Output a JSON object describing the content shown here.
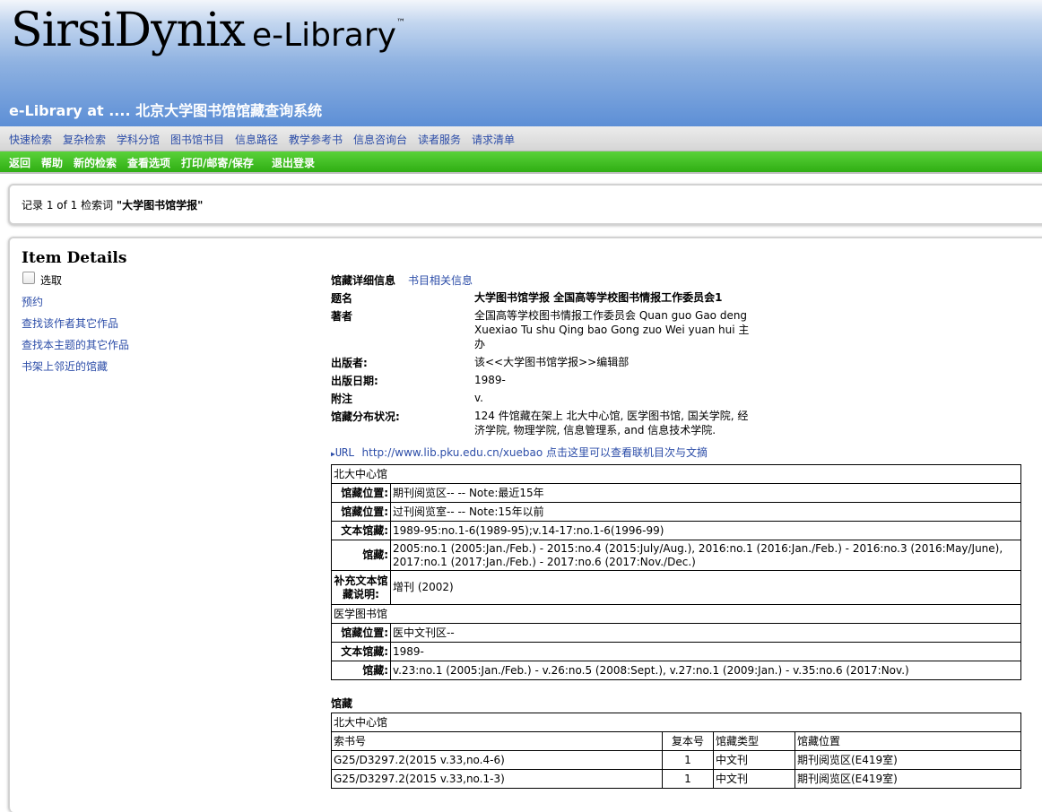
{
  "brand": {
    "name": "SirsiDynix",
    "product": "e-Library",
    "trademark": "™"
  },
  "site_title": "e-Library at .... 北京大学图书馆馆藏查询系统",
  "nav": [
    "快速检索",
    "复杂检索",
    "学科分馆",
    "图书馆书目",
    "信息路径",
    "教学参考书",
    "信息咨询台",
    "读者服务",
    "请求清单"
  ],
  "actions": [
    "返回",
    "帮助",
    "新的检索",
    "查看选项",
    "打印/邮寄/保存",
    "退出登录"
  ],
  "records": {
    "prefix": "记录 1 of 1 检索词 ",
    "term": "\"大学图书馆学报\""
  },
  "item_details": {
    "heading": "Item Details",
    "select_label": "选取",
    "links": [
      "预约",
      "查找该作者其它作品",
      "查找本主题的其它作品",
      "书架上邻近的馆藏"
    ]
  },
  "tabs": {
    "holdings": "馆藏详细信息",
    "bib": "书目相关信息"
  },
  "record": {
    "title_label": "题名",
    "title": "大学图书馆学报 全国高等学校图书情报工作委员会1",
    "author_label": "著者",
    "author_lines": [
      "全国高等学校图书情报工作委员会 Quan guo Gao deng",
      "Xuexiao Tu shu Qing bao Gong zuo Wei yuan hui 主",
      "办"
    ],
    "publisher_label": "出版者:",
    "publisher": "该<<大学图书馆学报>>编辑部",
    "date_label": "出版日期:",
    "date": "1989-",
    "note_label": "附注",
    "note": "v.",
    "dist_label": "馆藏分布状况:",
    "dist_lines": [
      "124 件馆藏在架上 北大中心馆, 医学图书馆, 国关学院, 经",
      "济学院, 物理学院, 信息管理系, and 信息技术学院."
    ]
  },
  "url": {
    "label": "URL",
    "text": "http://www.lib.pku.edu.cn/xuebao 点击这里可以查看联机目次与文摘"
  },
  "summary": {
    "library1": "北大中心馆",
    "loc_label": "馆藏位置:",
    "loc1a": "期刊阅览区-- -- Note:最近15年",
    "loc1b": "过刊阅览室-- -- Note:15年以前",
    "text_label": "文本馆藏:",
    "text1": "1989-95:no.1-6(1989-95);v.14-17:no.1-6(1996-99)",
    "holdings_label": "馆藏:",
    "holdings1": "2005:no.1 (2005:Jan./Feb.) - 2015:no.4 (2015:July/Aug.), 2016:no.1 (2016:Jan./Feb.) - 2016:no.3 (2016:May/June), 2017:no.1 (2017:Jan./Feb.) - 2017:no.6 (2017:Nov./Dec.)",
    "supp_label": "补充文本馆藏说明:",
    "supp1": "增刊 (2002)",
    "library2": "医学图书馆",
    "loc2": "医中文刊区--",
    "text2": "1989-",
    "holdings2": "v.23:no.1 (2005:Jan./Feb.) - v.26:no.5 (2008:Sept.), v.27:no.1 (2009:Jan.) - v.35:no.6 (2017:Nov.)"
  },
  "holdings": {
    "heading": "馆藏",
    "library": "北大中心馆",
    "columns": [
      "索书号",
      "复本号",
      "馆藏类型",
      "馆藏位置"
    ],
    "rows": [
      [
        "G25/D3297.2(2015 v.33,no.4-6)",
        "1",
        "中文刊",
        "期刊阅览区(E419室)"
      ],
      [
        "G25/D3297.2(2015 v.33,no.1-3)",
        "1",
        "中文刊",
        "期刊阅览区(E419室)"
      ]
    ]
  }
}
